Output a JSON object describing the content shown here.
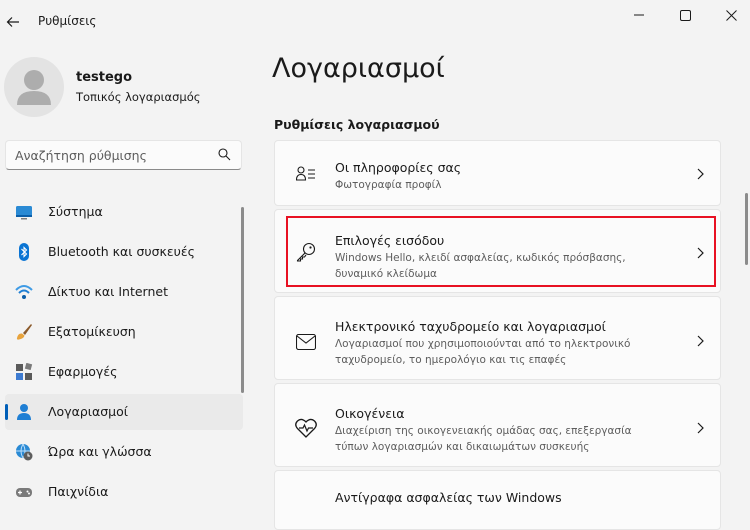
{
  "window": {
    "title": "Ρυθμίσεις"
  },
  "user": {
    "name": "testego",
    "account_type": "Τοπικός λογαριασμός"
  },
  "search": {
    "placeholder": "Αναζήτηση ρύθμισης"
  },
  "sidebar": {
    "items": [
      {
        "label": "Σύστημα",
        "icon": "system-icon",
        "active": false
      },
      {
        "label": "Bluetooth και συσκευές",
        "icon": "bluetooth-icon",
        "active": false
      },
      {
        "label": "Δίκτυο και Internet",
        "icon": "wifi-icon",
        "active": false
      },
      {
        "label": "Εξατομίκευση",
        "icon": "brush-icon",
        "active": false
      },
      {
        "label": "Εφαρμογές",
        "icon": "apps-icon",
        "active": false
      },
      {
        "label": "Λογαριασμοί",
        "icon": "person-icon",
        "active": true
      },
      {
        "label": "Ώρα και γλώσσα",
        "icon": "globe-clock-icon",
        "active": false
      },
      {
        "label": "Παιχνίδια",
        "icon": "gamepad-icon",
        "active": false
      }
    ]
  },
  "main": {
    "title": "Λογαριασμοί",
    "section": "Ρυθμίσεις λογαριασμού",
    "cards": [
      {
        "title": "Οι πληροφορίες σας",
        "desc": "Φωτογραφία προφίλ",
        "icon": "user-info-icon"
      },
      {
        "title": "Επιλογές εισόδου",
        "desc": "Windows Hello, κλειδί ασφαλείας, κωδικός πρόσβασης, δυναμικό κλείδωμα",
        "icon": "key-icon",
        "highlighted": true
      },
      {
        "title": "Ηλεκτρονικό ταχυδρομείο και λογαριασμοί",
        "desc": "Λογαριασμοί που χρησιμοποιούνται από το ηλεκτρονικό ταχυδρομείο, το ημερολόγιο και τις επαφές",
        "icon": "mail-icon"
      },
      {
        "title": "Οικογένεια",
        "desc": "Διαχείριση της οικογενειακής ομάδας σας, επεξεργασία τύπων λογαριασμών και δικαιωμάτων συσκευής",
        "icon": "family-heart-icon"
      },
      {
        "title": "Αντίγραφα ασφαλείας των Windows",
        "desc": "",
        "icon": "backup-icon"
      }
    ]
  },
  "colors": {
    "accent": "#005fb8",
    "highlight": "#e81123",
    "background": "#f3f3f3",
    "card": "#fbfbfb"
  }
}
